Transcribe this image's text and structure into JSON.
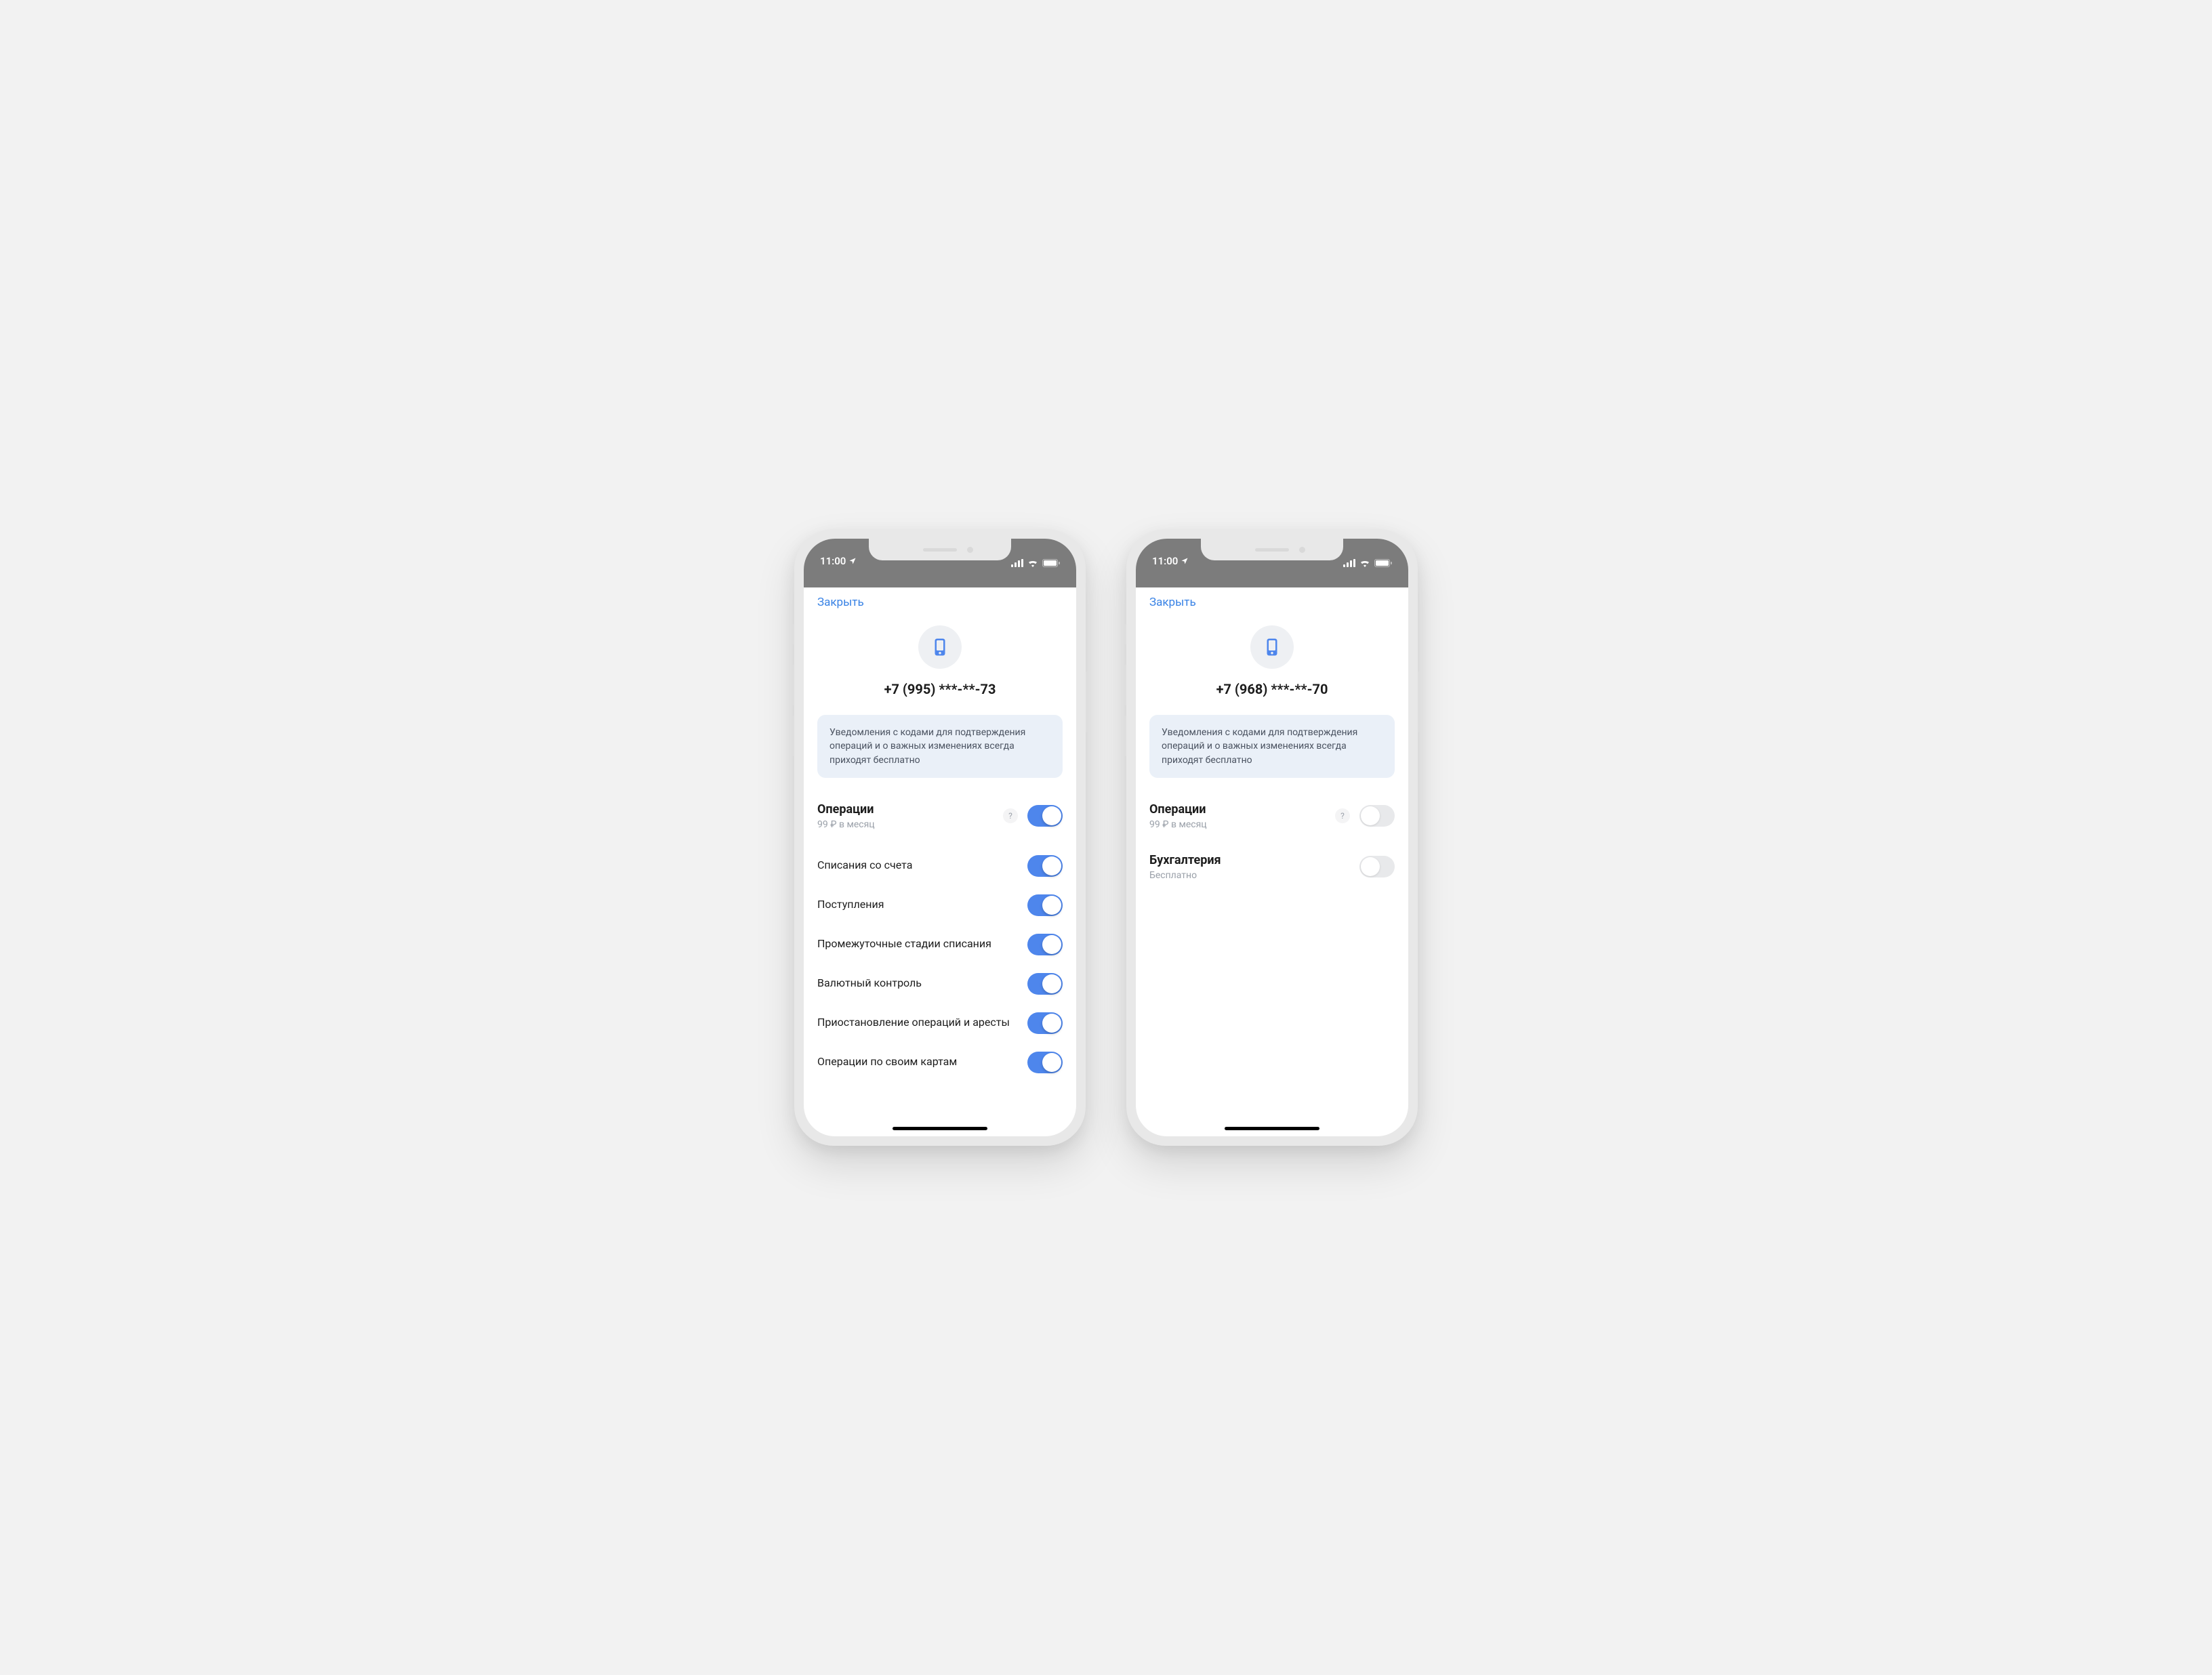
{
  "status": {
    "time": "11:00"
  },
  "nav": {
    "close": "Закрыть"
  },
  "info_text": "Уведомления с кодами для подтверждения операций и о важных изменениях всегда приходят бесплатно",
  "phones": [
    {
      "number": "+7 (995) ***-**-73",
      "sections": [
        {
          "title": "Операции",
          "subtitle": "99 ₽ в месяц",
          "has_help": true,
          "toggle_on": true,
          "rows": [
            {
              "label": "Списания со счета",
              "on": true
            },
            {
              "label": "Поступления",
              "on": true
            },
            {
              "label": "Промежуточные стадии списания",
              "on": true
            },
            {
              "label": "Валютный контроль",
              "on": true
            },
            {
              "label": "Приостановление операций и аресты",
              "on": true
            },
            {
              "label": "Операции по своим картам",
              "on": true
            }
          ]
        }
      ]
    },
    {
      "number": "+7 (968) ***-**-70",
      "sections": [
        {
          "title": "Операции",
          "subtitle": "99 ₽ в месяц",
          "has_help": true,
          "toggle_on": false,
          "rows": []
        },
        {
          "title": "Бухгалтерия",
          "subtitle": "Бесплатно",
          "has_help": false,
          "toggle_on": false,
          "rows": []
        }
      ]
    }
  ]
}
